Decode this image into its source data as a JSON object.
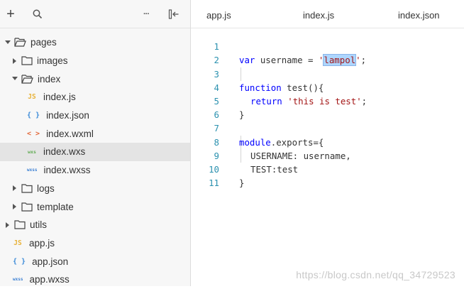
{
  "sidebar": {
    "toolbar": {
      "add_label": "+",
      "more_label": "···"
    },
    "tree": [
      {
        "label": "pages"
      },
      {
        "label": "images"
      },
      {
        "label": "index"
      },
      {
        "label": "index.js",
        "type": "JS"
      },
      {
        "label": "index.json",
        "type": "{ }"
      },
      {
        "label": "index.wxml",
        "type": "< >"
      },
      {
        "label": "index.wxs",
        "type": "wxs"
      },
      {
        "label": "index.wxss",
        "type": "wxss"
      },
      {
        "label": "logs"
      },
      {
        "label": "template"
      },
      {
        "label": "utils"
      },
      {
        "label": "app.js",
        "type": "JS"
      },
      {
        "label": "app.json",
        "type": "{ }"
      },
      {
        "label": "app.wxss",
        "type": "wxss"
      }
    ]
  },
  "editor": {
    "tabs": [
      "app.js",
      "index.js",
      "index.json"
    ],
    "line_numbers": [
      "1",
      "2",
      "3",
      "4",
      "5",
      "6",
      "7",
      "8",
      "9",
      "10",
      "11"
    ],
    "code": {
      "l1_kw": "var",
      "l1_a": " username = ",
      "l1_q1": "'",
      "l1_sel": "lampol",
      "l1_q2": "'",
      "l1_end": ";",
      "l3_kw": "function",
      "l3_rest": " test(){",
      "l4_kw": "return",
      "l4_str": "'this is test'",
      "l4_end": ";",
      "l5": "}",
      "l7_kw": "module",
      "l7_rest": ".exports={",
      "l8": "USERNAME: username,",
      "l9": "TEST:test",
      "l10": "}"
    }
  },
  "watermark": "https://blog.csdn.net/qq_34729523",
  "colors": {
    "keyword": "#0000ff",
    "string": "#a31515",
    "line_number": "#2b91af",
    "selection": "#add6ff"
  }
}
